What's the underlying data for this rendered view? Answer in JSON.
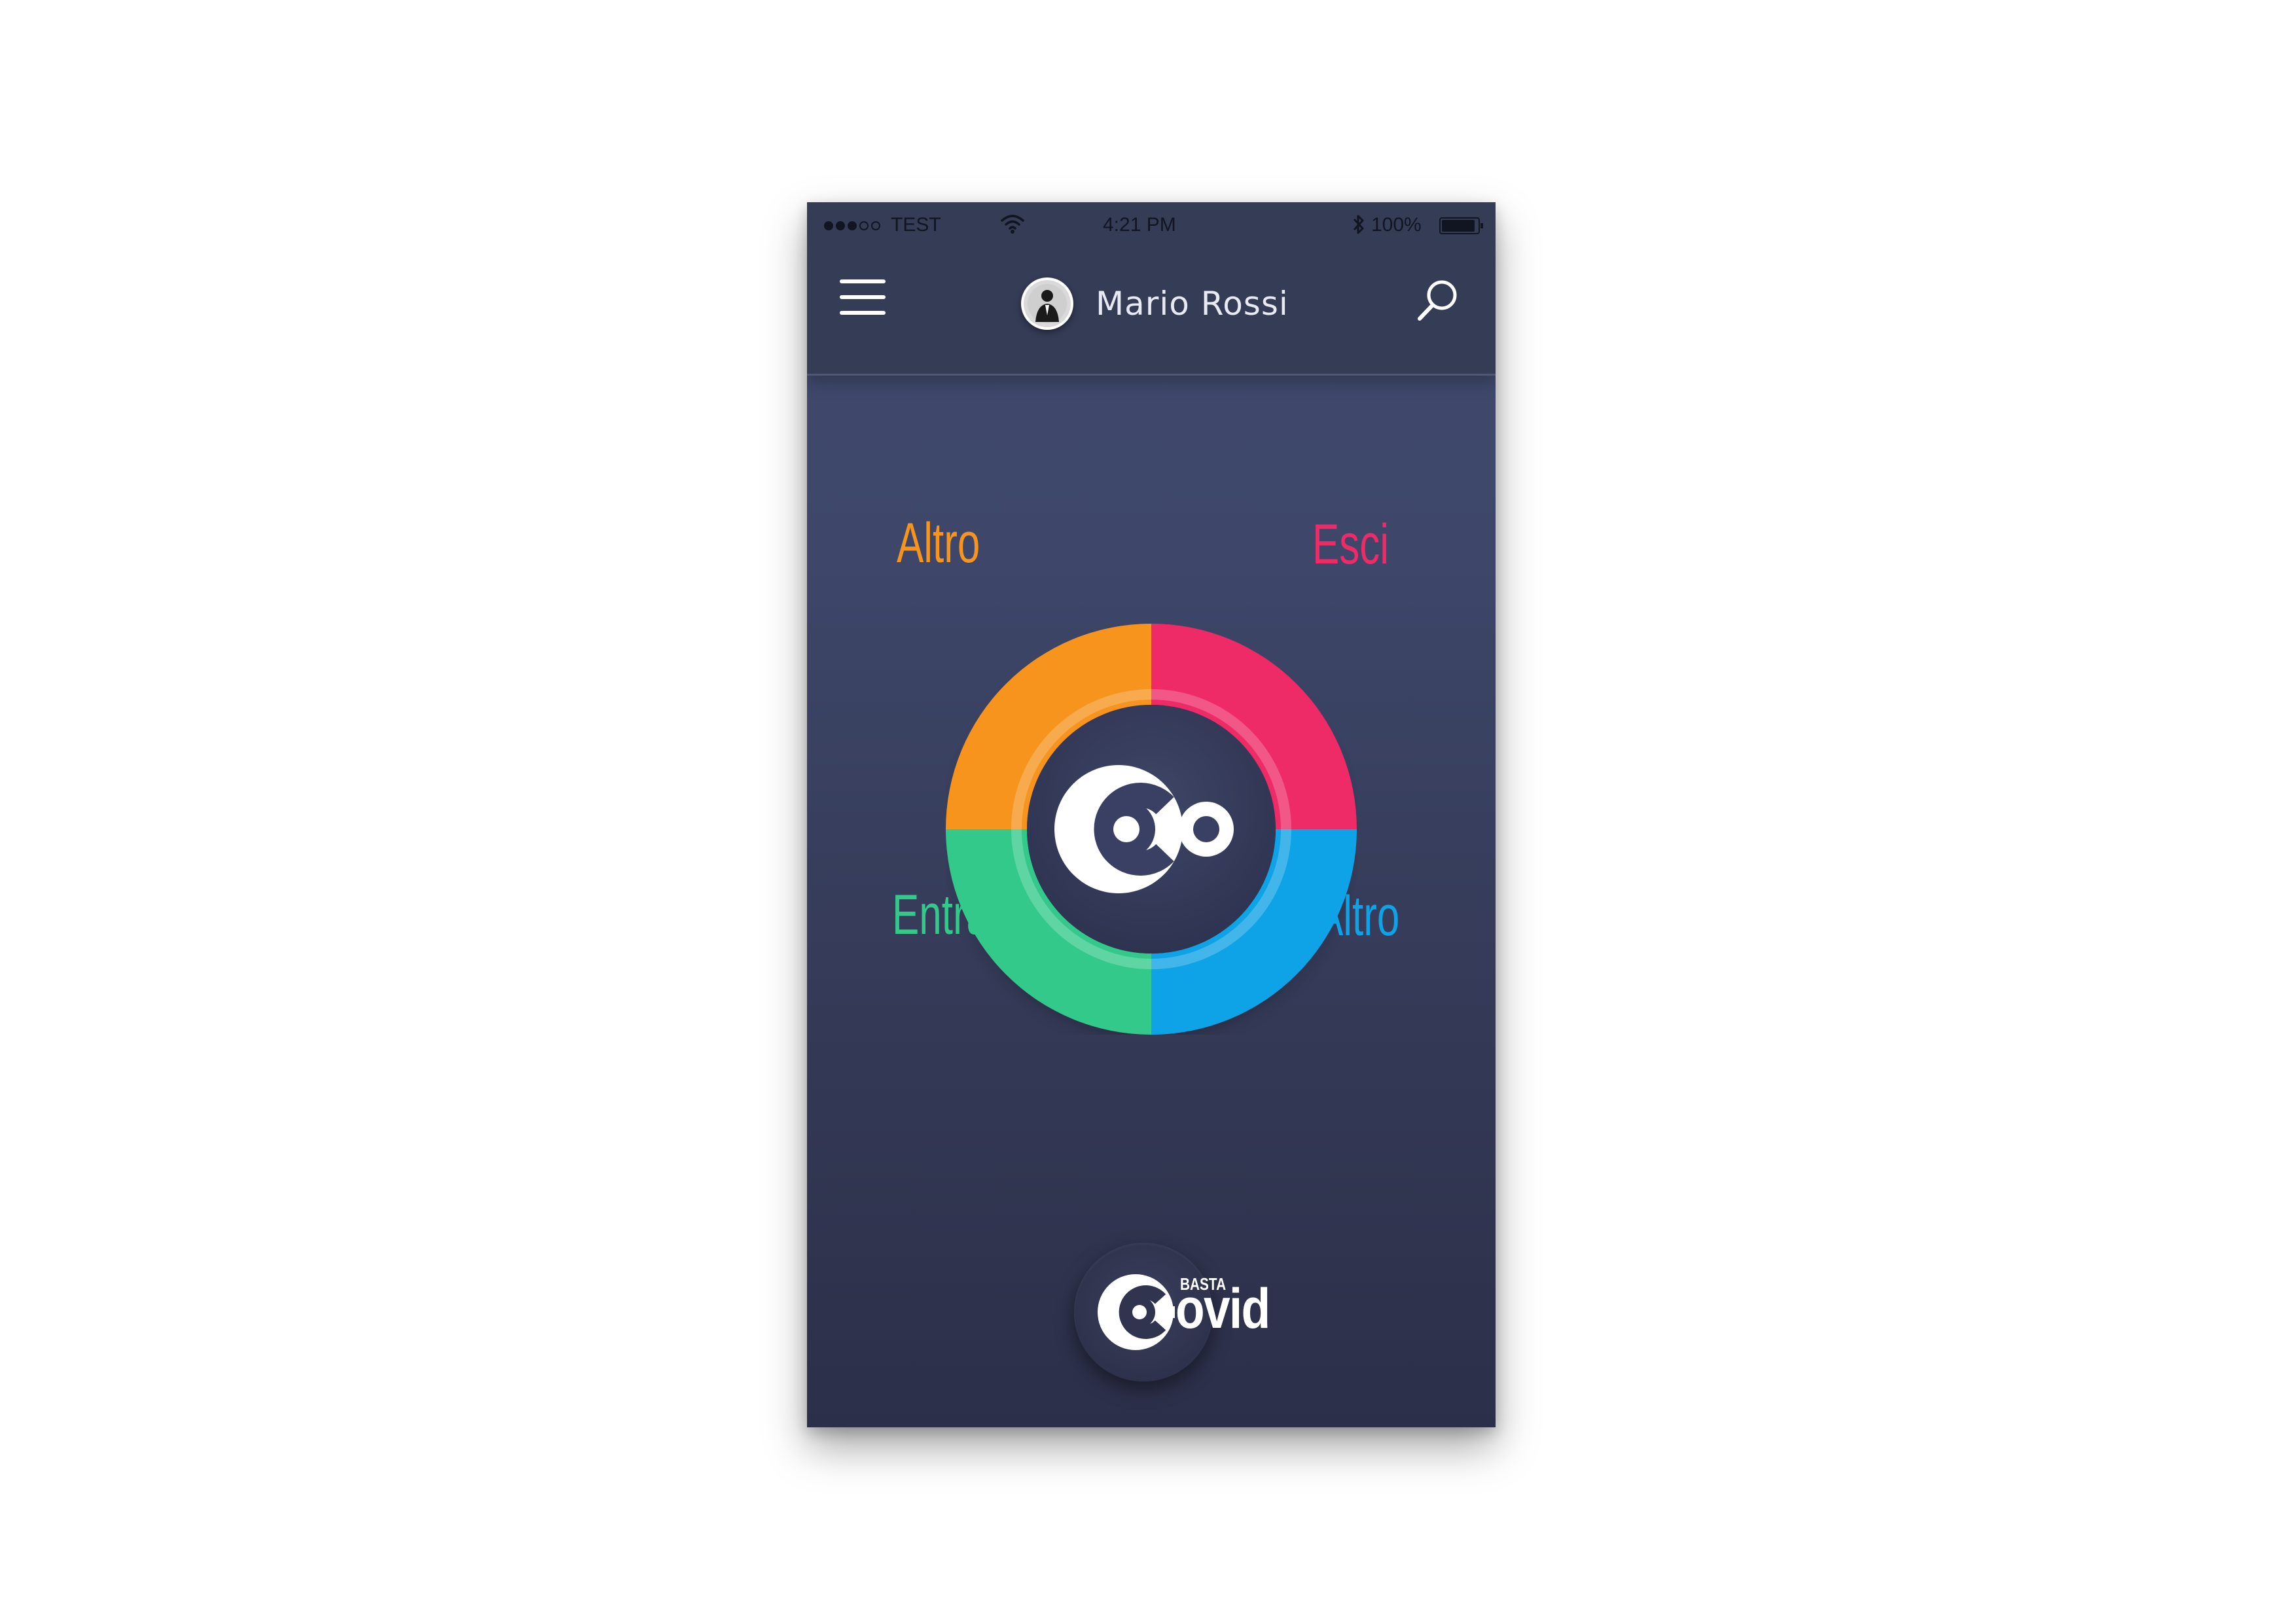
{
  "status_bar": {
    "carrier": "TEST",
    "time": "4:21 PM",
    "battery": "100%",
    "battery_level": 1.0,
    "signal_bars": 3,
    "signal_max": 5
  },
  "header": {
    "user_name": "Mario Rossi",
    "menu_icon": "hamburger-menu-icon",
    "search_icon": "search-icon",
    "avatar_icon": "user-avatar"
  },
  "wheel": {
    "segments": [
      {
        "label": "Altro",
        "color": "#f7941d",
        "position": "top-left"
      },
      {
        "label": "Esci",
        "color": "#ee2a67",
        "position": "top-right"
      },
      {
        "label": "Entra",
        "color": "#32c98a",
        "position": "bottom-left"
      },
      {
        "label": "Altro",
        "color": "#0ea2e6",
        "position": "bottom-right"
      }
    ],
    "center_icon": "covid-logo-icon"
  },
  "footer": {
    "logo_small": "BASTA",
    "logo_word": "ovid"
  },
  "colors": {
    "background_top": "#404a6c",
    "background_bottom": "#2c2f49",
    "header": "#353c56",
    "text_primary": "#e8eaf1"
  }
}
